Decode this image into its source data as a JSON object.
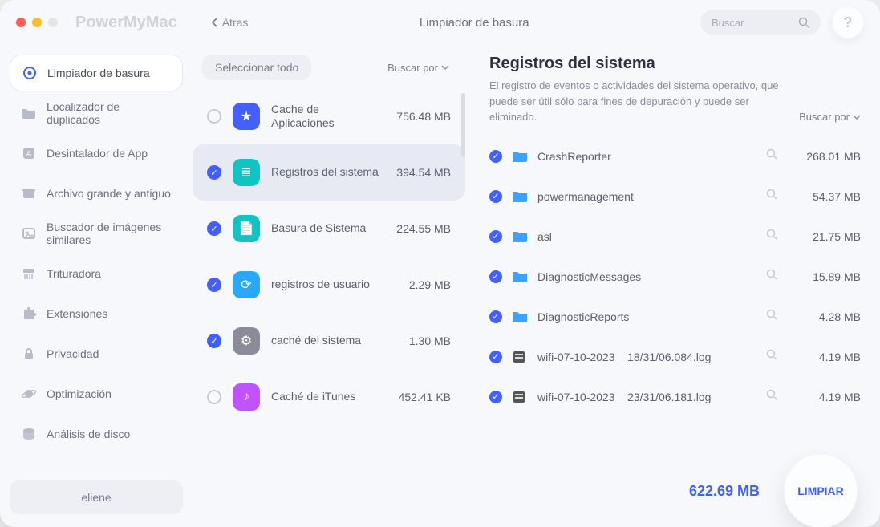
{
  "app_name": "PowerMyMac",
  "back_label": "Atras",
  "page_title": "Limpiador de basura",
  "search_placeholder": "Buscar",
  "help_label": "?",
  "user_name": "eliene",
  "select_all_label": "Seleccionar todo",
  "sort_label": "Buscar por",
  "total_size": "622.69 MB",
  "clean_label": "LIMPIAR",
  "sidebar": [
    {
      "name": "limpiador",
      "label": "Limpiador de basura",
      "active": true
    },
    {
      "name": "duplicados",
      "label": "Localizador de duplicados",
      "active": false
    },
    {
      "name": "desintalador",
      "label": "Desintalador de App",
      "active": false
    },
    {
      "name": "archivo",
      "label": "Archivo grande y antiguo",
      "active": false
    },
    {
      "name": "imagenes",
      "label": "Buscador de imágenes similares",
      "active": false
    },
    {
      "name": "trituradora",
      "label": "Trituradora",
      "active": false
    },
    {
      "name": "extensiones",
      "label": "Extensiones",
      "active": false
    },
    {
      "name": "privacidad",
      "label": "Privacidad",
      "active": false
    },
    {
      "name": "optimizacion",
      "label": "Optimización",
      "active": false
    },
    {
      "name": "analisis",
      "label": "Análisis de disco",
      "active": false
    }
  ],
  "categories": [
    {
      "name": "app-cache",
      "label": "Cache de Aplicaciones",
      "size": "756.48 MB",
      "checked": false,
      "selected": false,
      "color": "#4360ff",
      "glyph": "★"
    },
    {
      "name": "system-logs",
      "label": "Registros del sistema",
      "size": "394.54 MB",
      "checked": true,
      "selected": true,
      "color": "#13c2c2",
      "glyph": "≣"
    },
    {
      "name": "system-junk",
      "label": "Basura de Sistema",
      "size": "224.55 MB",
      "checked": true,
      "selected": false,
      "color": "#13c2c2",
      "glyph": "📄"
    },
    {
      "name": "user-logs",
      "label": "registros de usuario",
      "size": "2.29 MB",
      "checked": true,
      "selected": false,
      "color": "#2aa7ff",
      "glyph": "⟳"
    },
    {
      "name": "system-cache",
      "label": "caché del sistema",
      "size": "1.30 MB",
      "checked": true,
      "selected": false,
      "color": "#8a8d99",
      "glyph": "⚙"
    },
    {
      "name": "itunes-cache",
      "label": "Caché de iTunes",
      "size": "452.41 KB",
      "checked": false,
      "selected": false,
      "color": "#c152ff",
      "glyph": "♪"
    }
  ],
  "detail": {
    "title": "Registros del sistema",
    "description": "El registro de eventos o actividades del sistema operativo, que puede ser útil sólo para fines de depuración y puede ser eliminado.",
    "sort_label": "Buscar por",
    "files": [
      {
        "name": "CrashReporter",
        "size": "268.01 MB",
        "type": "folder",
        "checked": true
      },
      {
        "name": "powermanagement",
        "size": "54.37 MB",
        "type": "folder",
        "checked": true
      },
      {
        "name": "asl",
        "size": "21.75 MB",
        "type": "folder",
        "checked": true
      },
      {
        "name": "DiagnosticMessages",
        "size": "15.89 MB",
        "type": "folder",
        "checked": true
      },
      {
        "name": "DiagnosticReports",
        "size": "4.28 MB",
        "type": "folder",
        "checked": true
      },
      {
        "name": "wifi-07-10-2023__18/31/06.084.log",
        "size": "4.19 MB",
        "type": "file",
        "checked": true
      },
      {
        "name": "wifi-07-10-2023__23/31/06.181.log",
        "size": "4.19 MB",
        "type": "file",
        "checked": true
      }
    ]
  },
  "icons": {
    "sidebar": {
      "limpiador": "target",
      "duplicados": "folder",
      "desintalador": "app",
      "archivo": "box",
      "imagenes": "image",
      "trituradora": "shred",
      "extensiones": "puzzle",
      "privacidad": "lock",
      "optimizacion": "planet",
      "analisis": "disk"
    }
  }
}
